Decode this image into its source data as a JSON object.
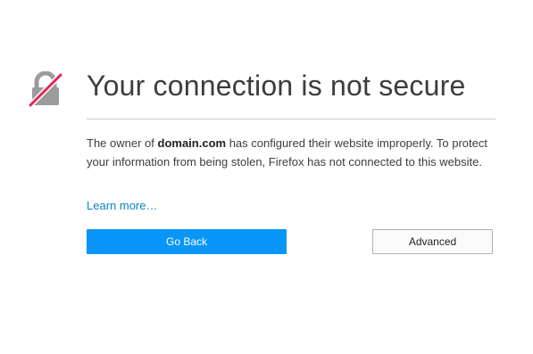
{
  "error_page": {
    "title": "Your connection is not secure",
    "description": {
      "prefix": "The owner of ",
      "domain": "domain.com",
      "suffix": " has configured their website improperly. To protect your information from being stolen, Firefox has not connected to this website."
    },
    "learn_more_label": "Learn more…",
    "go_back_label": "Go Back",
    "advanced_label": "Advanced",
    "icon": "broken-lock-icon"
  },
  "colors": {
    "primary_button": "#0996f8",
    "link": "#0a84c7",
    "lock_gray": "#9b9b9b",
    "slash_red": "#e22850",
    "text": "#3d3d3d"
  }
}
